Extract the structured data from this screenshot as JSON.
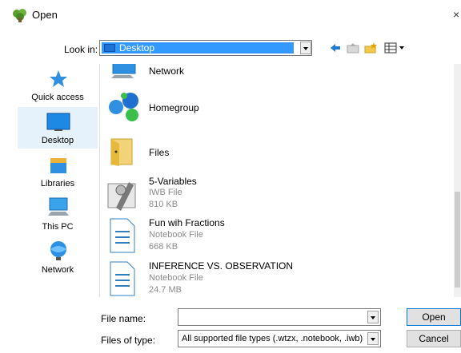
{
  "window": {
    "title": "Open"
  },
  "lookin": {
    "label": "Look in:",
    "value": "Desktop"
  },
  "toolbar": {
    "back_icon": "back-arrow-icon",
    "up_icon": "up-folder-icon",
    "new_folder_icon": "new-folder-icon",
    "view_icon": "view-menu-icon"
  },
  "places": [
    {
      "label": "Quick access",
      "icon": "star-icon"
    },
    {
      "label": "Desktop",
      "icon": "desktop-icon",
      "selected": true
    },
    {
      "label": "Libraries",
      "icon": "libraries-icon"
    },
    {
      "label": "This PC",
      "icon": "computer-icon"
    },
    {
      "label": "Network",
      "icon": "network-icon"
    }
  ],
  "files": [
    {
      "name": "Network",
      "type": "",
      "size": "",
      "icon": "network-icon"
    },
    {
      "name": "Homegroup",
      "type": "",
      "size": "",
      "icon": "homegroup-icon"
    },
    {
      "name": "Files",
      "type": "",
      "size": "",
      "icon": "folder-icon"
    },
    {
      "name": "5-Variables",
      "type": "IWB File",
      "size": "810 KB",
      "icon": "iwb-file-icon"
    },
    {
      "name": "Fun wih Fractions",
      "type": "Notebook File",
      "size": "668 KB",
      "icon": "document-icon"
    },
    {
      "name": "INFERENCE VS. OBSERVATION",
      "type": "Notebook File",
      "size": "24.7 MB",
      "icon": "document-icon"
    }
  ],
  "filename": {
    "label": "File name:",
    "value": ""
  },
  "filetype": {
    "label": "Files of type:",
    "value": "All supported file types (.wtzx, .notebook, .iwb)"
  },
  "buttons": {
    "open": "Open",
    "cancel": "Cancel"
  },
  "colors": {
    "selection": "#3399ff",
    "accent": "#0078d7",
    "muted_text": "#8a8a8a"
  }
}
